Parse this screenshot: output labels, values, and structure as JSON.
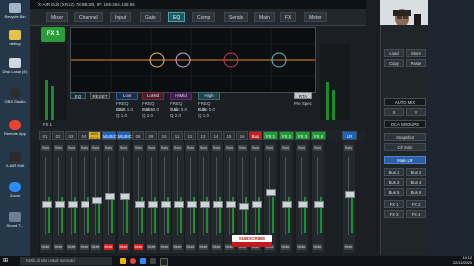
{
  "window": {
    "title": "X-AIR Edit (XR12) 78:8B:2B, IP: 169.254.138.95"
  },
  "desktop_icons": [
    "Recycle Bin",
    "debug",
    "Disk Lokal (E)",
    "Mi...",
    "OBS Studio",
    "Remote App",
    "X-AIR Edit",
    "Zoom",
    "Smart T..."
  ],
  "tabs": [
    "Mixer",
    "Channel",
    "Input",
    "Gate",
    "EQ",
    "Comp",
    "Sends",
    "Main",
    "FX",
    "Meter"
  ],
  "fx": {
    "label": "FX 1",
    "left_scale": "FX 1"
  },
  "eq": {
    "eq_button": "EQ",
    "reset_button": "RESET",
    "rta_button": "RTA",
    "pre_label": "Pre",
    "spec_label": "Spec",
    "bands": [
      {
        "name": "Low",
        "freq": "69.0",
        "gain": "1.0",
        "q": "1.0"
      },
      {
        "name": "LoMid",
        "freq": "248.5",
        "gain": "0.0",
        "q": "2.0"
      },
      {
        "name": "HiMid",
        "freq": "1.5k",
        "gain": "0.0",
        "q": "2.0"
      },
      {
        "name": "High",
        "freq": "8.0k",
        "gain": "0.0",
        "q": "1.0"
      }
    ],
    "param_labels": {
      "freq": "FREQ",
      "gain": "Gain",
      "q": "Q"
    }
  },
  "channels": [
    "01",
    "02",
    "03",
    "04",
    "AMS P128",
    "MUSIC",
    "MUSIC",
    "08",
    "09",
    "10",
    "11",
    "12",
    "13",
    "14",
    "15",
    "16",
    "Bus",
    "FX 1",
    "FX 2",
    "FX 3",
    "FX 4",
    "LR"
  ],
  "strip_labels": {
    "solo": "Solo",
    "mute": "Mute",
    "main": "Main LR"
  },
  "subscribe": "SUBSCRIBE",
  "right_panel": {
    "load": "Load",
    "store": "Store",
    "copy": "Copy",
    "paste": "Paste",
    "auto_mix": "AUTO MIX",
    "x": "X",
    "y": "Y",
    "dca": "DCA GROUPS",
    "snapshot": "Snapshot",
    "clr_solo": "Clr Solo",
    "buses": [
      "Bus 1",
      "Bus 2",
      "Bus 3",
      "Bus 4",
      "Bus 5",
      "Bus 6"
    ],
    "fxs": [
      "FX 1",
      "FX 2",
      "FX 3",
      "FX 4"
    ],
    "main_lr": "Main LR"
  },
  "taskbar": {
    "search": "Ketik di sini untuk mencari",
    "time": "14.12",
    "date": "22/12/2020"
  },
  "colors": {
    "accent": "#1c5a63",
    "green": "#1f9a36",
    "red": "#c81e1e",
    "eq_curve": "#e08a2a"
  }
}
